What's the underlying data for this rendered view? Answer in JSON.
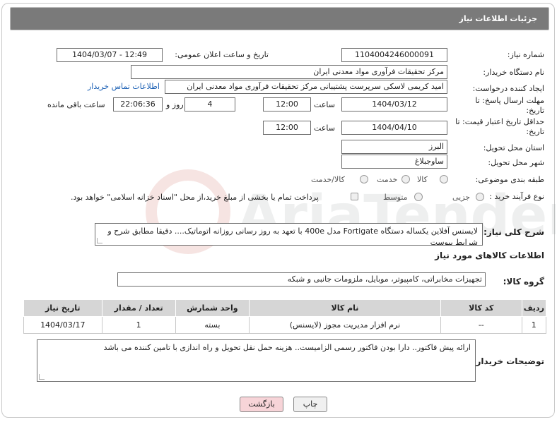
{
  "header": {
    "title": "جزئیات اطلاعات نیاز"
  },
  "fields": {
    "need_number_label": "شماره نیاز:",
    "need_number": "1104004246000091",
    "announce_label": "تاریخ و ساعت اعلان عمومی:",
    "announce_value": "1404/03/07 - 12:49",
    "buyer_org_label": "نام دستگاه خریدار:",
    "buyer_org": "مرکز تحقیقات فرآوری مواد معدنی ایران",
    "requester_label": "ایجاد کننده درخواست:",
    "requester": "امید کریمی لاسکی سرپرست پشتیبانی مرکز تحقیقات فرآوری مواد معدنی ایران",
    "contact_link": "اطلاعات تماس خریدار",
    "reply_deadline_label": "مهلت ارسال پاسخ: تا تاریخ:",
    "reply_date": "1404/03/12",
    "hour_label": "ساعت",
    "reply_time": "12:00",
    "days_value": "4",
    "days_label": "روز و",
    "remaining_time": "22:06:36",
    "remaining_label": "ساعت باقی مانده",
    "price_validity_label": "حداقل تاریخ اعتبار قیمت: تا تاریخ:",
    "price_date": "1404/04/10",
    "price_time": "12:00",
    "province_label": "استان محل تحویل:",
    "province": "البرز",
    "city_label": "شهر محل تحویل:",
    "city": "ساوجبلاغ",
    "category_label": "طبقه بندی موضوعی:",
    "category_options": [
      "کالا",
      "خدمت",
      "کالا/خدمت"
    ],
    "process_label": "نوع فرآیند خرید :",
    "process_options": [
      "جزیی",
      "متوسط"
    ],
    "payment_note": "پرداخت تمام یا بخشی از مبلغ خرید،از محل \"اسناد خزانه اسلامی\" خواهد بود."
  },
  "description": {
    "label": "شرح کلی نیاز:",
    "text": "لایسنس آفلاین یکساله دستگاه Fortigate  مدل 400e با تعهد به روز رسانی روزانه اتوماتیک.... دقیقا مطابق شرح و شرایط پیوست"
  },
  "goods_section": {
    "title": "اطلاعات کالاهای مورد نیاز",
    "group_label": "گروه کالا:",
    "group_value": "تجهیزات مخابراتی، کامپیوتر، موبایل، ملزومات جانبی و شبکه"
  },
  "table": {
    "headers": [
      "ردیف",
      "کد کالا",
      "نام کالا",
      "واحد شمارش",
      "تعداد / مقدار",
      "تاریخ نیاز"
    ],
    "rows": [
      [
        "1",
        "--",
        "نرم افزار مدیریت مجوز (لایسنس)",
        "بسته",
        "1",
        "1404/03/17"
      ]
    ]
  },
  "buyer_notes": {
    "label": "توضیحات خریدار:",
    "text": "ارائه پیش فاکتور.. دارا بودن فاکتور رسمی الزامیست.. هزینه حمل نقل تحویل و راه اندازی با تامین کننده می باشد"
  },
  "buttons": {
    "print": "چاپ",
    "back": "بازگشت"
  },
  "watermark": {
    "brand": "AriaTender.neT"
  }
}
